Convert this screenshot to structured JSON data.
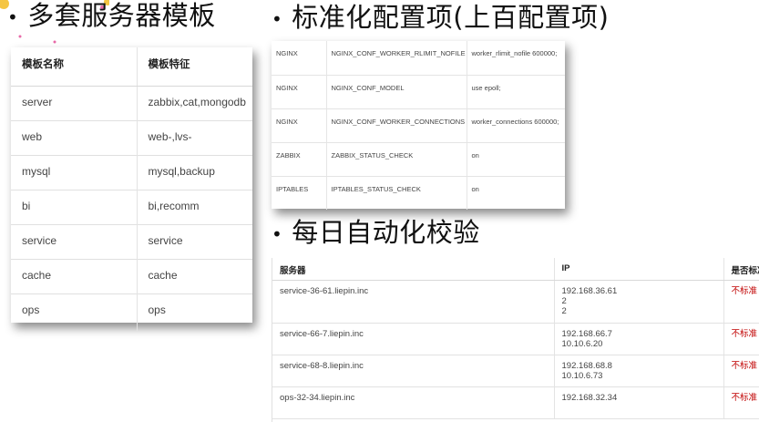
{
  "headings": {
    "server_templates": "多套服务器模板",
    "standard_config": "标准化配置项(上百配置项)",
    "daily_check": "每日自动化校验",
    "bullet": "•"
  },
  "templates_table": {
    "headers": [
      "模板名称",
      "模板特征"
    ],
    "rows": [
      [
        "server",
        "zabbix,cat,mongodb"
      ],
      [
        "web",
        "web-,lvs-"
      ],
      [
        "mysql",
        "mysql,backup"
      ],
      [
        "bi",
        "bi,recomm"
      ],
      [
        "service",
        "service"
      ],
      [
        "cache",
        "cache"
      ],
      [
        "ops",
        "ops"
      ]
    ]
  },
  "config_table": {
    "rows": [
      [
        "NGINX",
        "NGINX_CONF_WORKER_RLIMIT_NOFILE",
        "worker_rlimit_nofile 600000;"
      ],
      [
        "NGINX",
        "NGINX_CONF_MODEL",
        "use epoll;"
      ],
      [
        "NGINX",
        "NGINX_CONF_WORKER_CONNECTIONS",
        "worker_connections 600000;"
      ],
      [
        "ZABBIX",
        "ZABBIX_STATUS_CHECK",
        "on"
      ],
      [
        "IPTABLES",
        "IPTABLES_STATUS_CHECK",
        "on"
      ]
    ]
  },
  "check_table": {
    "headers": [
      "服务器",
      "IP",
      "是否标准"
    ],
    "rows": [
      {
        "host": "service-36-61.liepin.inc",
        "ip": [
          "192.168.36.61",
          "2",
          "2"
        ],
        "status": "不标准"
      },
      {
        "host": "service-66-7.liepin.inc",
        "ip": [
          "192.168.66.7",
          "10.10.6.20"
        ],
        "status": "不标准"
      },
      {
        "host": "service-68-8.liepin.inc",
        "ip": [
          "192.168.68.8",
          "10.10.6.73"
        ],
        "status": "不标准"
      },
      {
        "host": "ops-32-34.liepin.inc",
        "ip": [
          "192.168.32.34"
        ],
        "status": "不标准"
      }
    ]
  },
  "colors": {
    "flag_red": "#c00000",
    "deco_yellow": "#f5c542",
    "deco_pink": "#e86aa8"
  }
}
